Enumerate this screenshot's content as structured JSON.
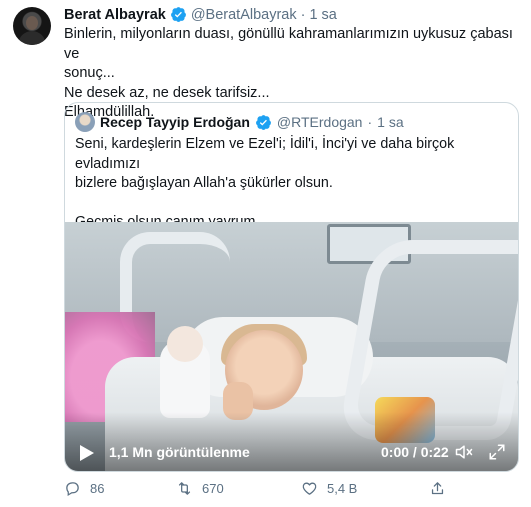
{
  "tweet": {
    "author_name": "Berat Albayrak",
    "handle": "@BeratAlbayrak",
    "separator": "·",
    "time": "1 sa",
    "text_lines": [
      "Binlerin, milyonların duası, gönüllü kahramanlarımızın uykusuz çabası ve",
      "sonuç...",
      "Ne desek az, ne desek tarifsiz...",
      "Elhamdülillah."
    ]
  },
  "quote": {
    "author_name": "Recep Tayyip Erdoğan",
    "handle": "@RTErdogan",
    "separator": "·",
    "time": "1 sa",
    "text_lines": [
      "Seni, kardeşlerin Elzem ve Ezel'i; İdil'i, İnci'yi ve daha birçok evladımızı",
      "bizlere bağışlayan Allah'a şükürler olsun.",
      "",
      "Geçmiş olsun canım yavrum..."
    ]
  },
  "video": {
    "views": "1,1 Mn görüntülenme",
    "duration": "0:00 / 0:22",
    "progress": 0
  },
  "actions": {
    "replies": "86",
    "retweets": "670",
    "likes": "5,4 B"
  },
  "colors": {
    "verified": "#1da1f2",
    "muted_text": "#5b7083",
    "border": "#cfd9de"
  }
}
